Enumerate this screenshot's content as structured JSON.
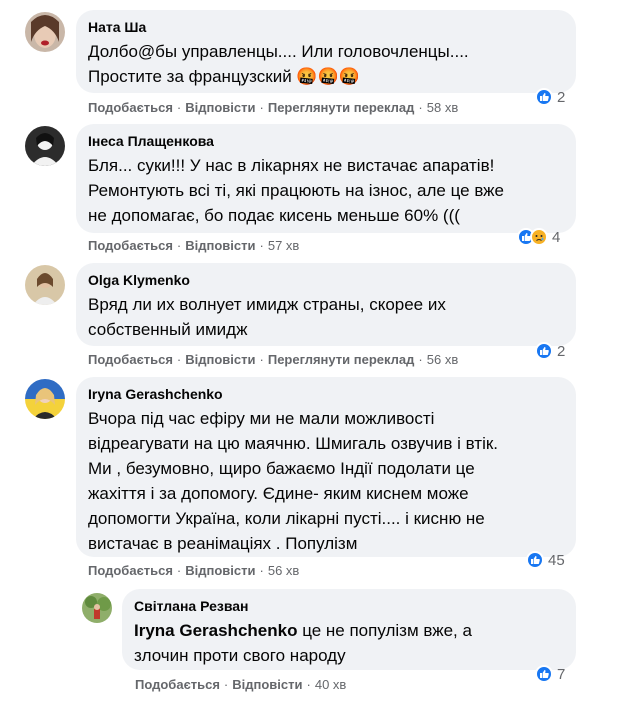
{
  "actions": {
    "like": "Подобається",
    "reply": "Відповісти",
    "translate": "Переглянути переклад",
    "dot": "·"
  },
  "comments": [
    {
      "author": "Ната Ша",
      "lines": [
        "Долбо@бы управленцы.... Или головочленцы....",
        "Простите за французский 🤬🤬🤬"
      ],
      "time": "58 хв",
      "has_translate": true,
      "reactions": {
        "types": [
          "like"
        ],
        "count": "2"
      }
    },
    {
      "author": "Інеса Плащенкова",
      "lines": [
        "Бля... суки!!! У нас в лікарнях не вистачає апаратів!",
        "Ремонтують всі ті, які працюють на ізнос, але це вже",
        "не допомагає, бо подає кисень меньше 60% ((("
      ],
      "time": "57 хв",
      "has_translate": false,
      "reactions": {
        "types": [
          "like",
          "sad"
        ],
        "count": "4"
      }
    },
    {
      "author": "Olga Klymenko",
      "lines": [
        "Вряд ли их волнует имидж страны, скорее их",
        "собственный имидж"
      ],
      "time": "56 хв",
      "has_translate": true,
      "reactions": {
        "types": [
          "like"
        ],
        "count": "2"
      }
    },
    {
      "author": "Iryna Gerashchenko",
      "lines": [
        "Вчора під час ефіру ми не мали можливості",
        "відреагувати на цю маячню. Шмигаль озвучив і втік.",
        "Ми , безумовно, щиро бажаємо Індії подолати це",
        "жахіття і за допомогу. Єдине- яким киснем може",
        "допомогти Україна, коли лікарні пусті.... і кисню не",
        "вистачає в реанімаціях . Популізм"
      ],
      "time": "56 хв",
      "has_translate": false,
      "reactions": {
        "types": [
          "like"
        ],
        "count": "45"
      }
    },
    {
      "author": "Світлана Резван",
      "mention": "Iryna Gerashchenko",
      "lines": [
        " це не популізм вже, а",
        "злочин проти свого народу"
      ],
      "time": "40 хв",
      "has_translate": false,
      "reactions": {
        "types": [
          "like"
        ],
        "count": "7"
      }
    }
  ],
  "colors": {
    "bubble": "#f0f2f5",
    "like_blue": "#1877f2",
    "sad_yellow": "#f7b125",
    "meta_gray": "#65676b"
  }
}
